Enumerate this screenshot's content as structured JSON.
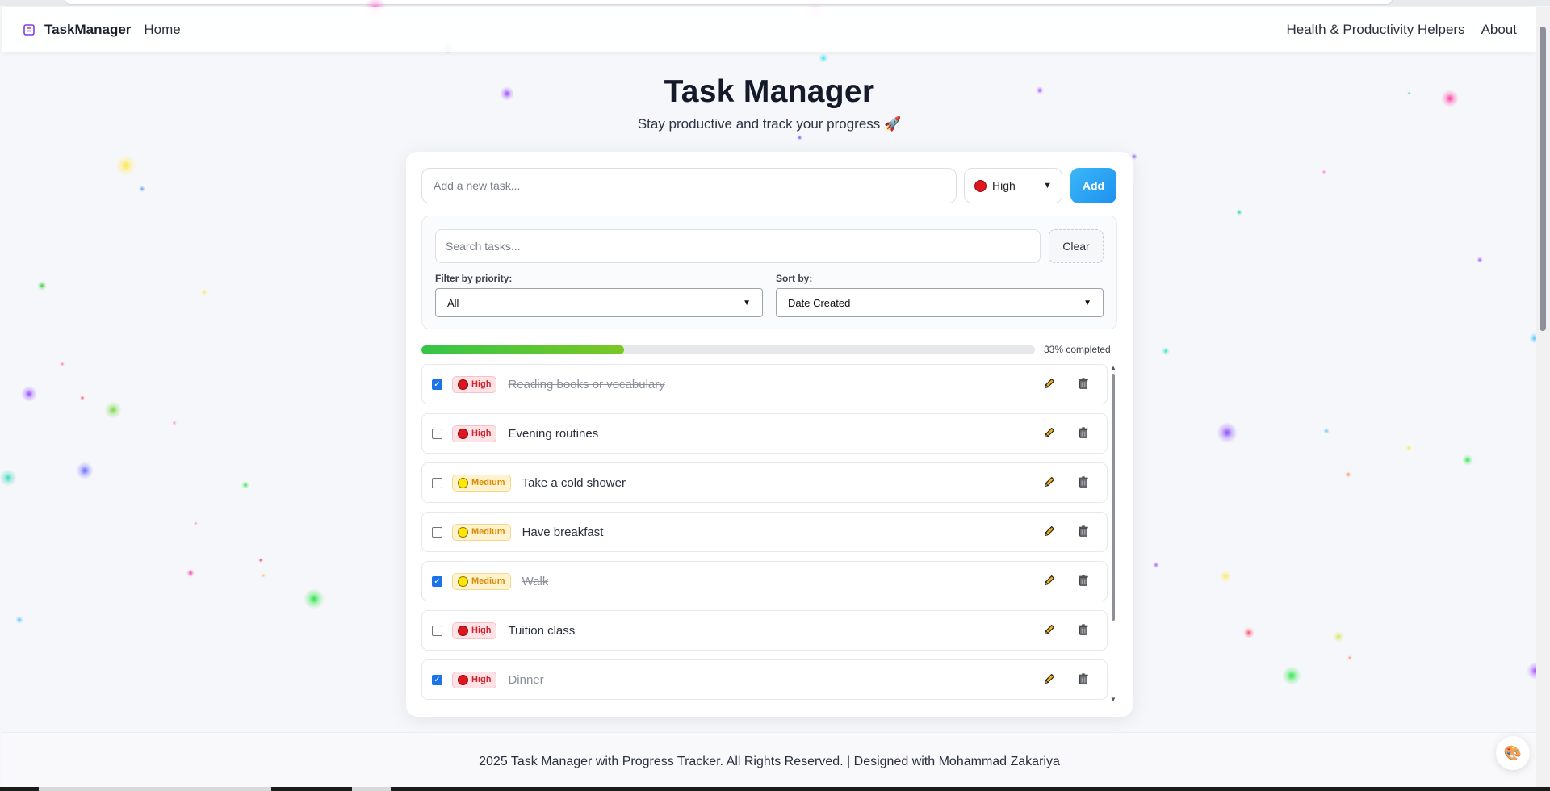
{
  "navbar": {
    "brand": "TaskManager",
    "home_label": "Home",
    "links": [
      "Health & Productivity Helpers",
      "About"
    ]
  },
  "header": {
    "title": "Task Manager",
    "subtitle": "Stay productive and track your progress 🚀"
  },
  "add_task": {
    "placeholder": "Add a new task...",
    "priority_selected": "High",
    "add_label": "Add"
  },
  "filters": {
    "search_placeholder": "Search tasks...",
    "clear_label": "Clear",
    "filter_label": "Filter by priority:",
    "filter_value": "All",
    "sort_label": "Sort by:",
    "sort_value": "Date Created"
  },
  "progress": {
    "percent": 33,
    "label": "33% completed"
  },
  "tasks": [
    {
      "text": "Reading books or vocabulary",
      "priority": "High",
      "done": true
    },
    {
      "text": "Evening routines",
      "priority": "High",
      "done": false
    },
    {
      "text": "Take a cold shower",
      "priority": "Medium",
      "done": false
    },
    {
      "text": "Have breakfast",
      "priority": "Medium",
      "done": false
    },
    {
      "text": "Walk",
      "priority": "Medium",
      "done": true
    },
    {
      "text": "Tuition class",
      "priority": "High",
      "done": false
    },
    {
      "text": "Dinner",
      "priority": "High",
      "done": true
    }
  ],
  "footer": {
    "text": "2025 Task Manager with Progress Tracker. All Rights Reserved. | Designed with Mohammad Zakariya"
  },
  "icons": {
    "edit": "pencil-icon",
    "delete": "trash-icon",
    "theme": "palette-icon",
    "brand": "app-logo-icon"
  },
  "colors": {
    "accent": "#1e90f0",
    "high": "#e0161e",
    "medium": "#ffe600",
    "progress": "#35c548"
  }
}
